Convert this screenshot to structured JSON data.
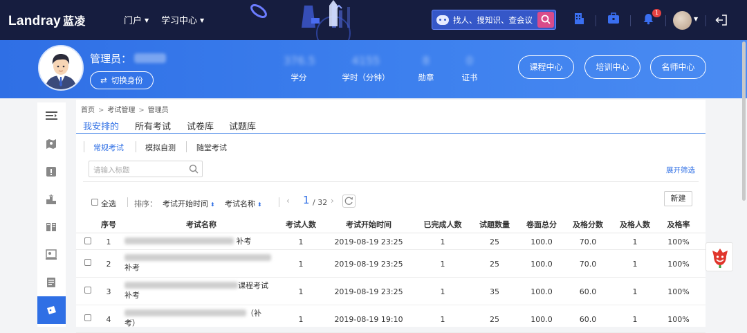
{
  "nav": {
    "logo": "Landray",
    "logo_cn": "蓝凌",
    "menu": [
      {
        "label": "门户"
      },
      {
        "label": "学习中心"
      }
    ],
    "search_placeholder": "找人、搜知识、查会议",
    "notification_count": "1",
    "icons": [
      "building-icon",
      "briefcase-icon",
      "bell-icon",
      "logout-icon"
    ]
  },
  "banner": {
    "admin_label": "管理员：",
    "switch_identity": "切换身份",
    "stats": [
      {
        "value": "376.5",
        "label": "学分"
      },
      {
        "value": "4155",
        "label": "学时（分钟）"
      },
      {
        "value": "8",
        "label": "勋章"
      },
      {
        "value": "0",
        "label": "证书"
      }
    ],
    "buttons": [
      "课程中心",
      "培训中心",
      "名师中心"
    ]
  },
  "breadcrumb": [
    "首页",
    "考试管理",
    "管理员"
  ],
  "tabs": [
    "我安排的",
    "所有考试",
    "试卷库",
    "试题库"
  ],
  "subtabs": [
    "常规考试",
    "模拟自测",
    "随堂考试"
  ],
  "search": {
    "placeholder": "请输入标题"
  },
  "expand_filter": "展开筛选",
  "toolbar": {
    "select_all": "全选",
    "sort_label": "排序：",
    "sort_fields": [
      "考试开始时间",
      "考试名称"
    ],
    "page_current": "1",
    "page_total": "/ 32",
    "new_button": "新建"
  },
  "table": {
    "headers": [
      "序号",
      "考试名称",
      "考试人数",
      "考试开始时间",
      "已完成人数",
      "试题数量",
      "卷面总分",
      "及格分数",
      "及格人数",
      "及格率"
    ],
    "rows": [
      {
        "index": "1",
        "name_line1": "补考",
        "name_line2": "",
        "examinees": "1",
        "start": "2019-08-19 23:25",
        "completed": "1",
        "questions": "25",
        "total": "100.0",
        "pass_score": "70.0",
        "passed": "1",
        "rate": "100%"
      },
      {
        "index": "2",
        "name_line1": "",
        "name_line2": "补考",
        "examinees": "1",
        "start": "2019-08-19 23:25",
        "completed": "1",
        "questions": "25",
        "total": "100.0",
        "pass_score": "70.0",
        "passed": "1",
        "rate": "100%"
      },
      {
        "index": "3",
        "name_line1": "课程考试",
        "name_line2": "补考",
        "examinees": "1",
        "start": "2019-08-19 23:25",
        "completed": "1",
        "questions": "35",
        "total": "100.0",
        "pass_score": "60.0",
        "passed": "1",
        "rate": "100%"
      },
      {
        "index": "4",
        "name_line1": "（补",
        "name_line2": "考）",
        "examinees": "1",
        "start": "2019-08-19 19:10",
        "completed": "1",
        "questions": "25",
        "total": "100.0",
        "pass_score": "60.0",
        "passed": "1",
        "rate": "100%"
      }
    ]
  },
  "colors": {
    "nav_bg": "#161d3f",
    "banner": "#3d80ee",
    "accent": "#2f6fe5",
    "badge": "#e64242"
  }
}
